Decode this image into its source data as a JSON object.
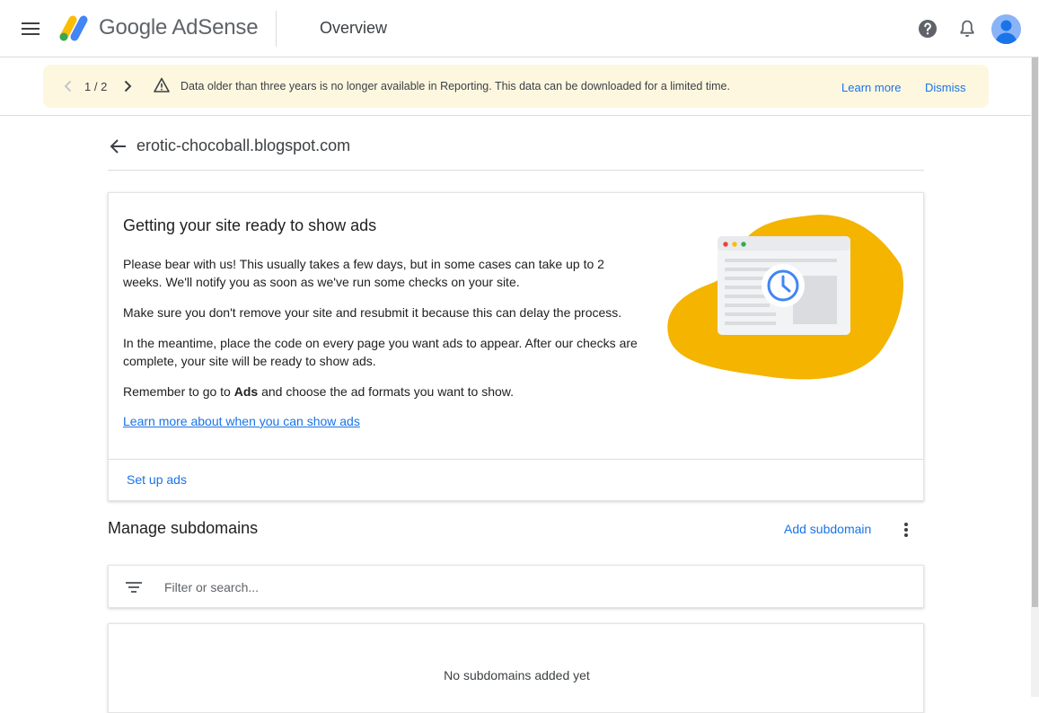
{
  "app": {
    "brand": "Google AdSense",
    "page_title": "Overview"
  },
  "icons": {
    "menu": "menu-icon",
    "help": "help-icon",
    "notifications": "bell-icon",
    "account": "account-icon"
  },
  "banner": {
    "pager": "1 / 2",
    "message": "Data older than three years is no longer available in Reporting. This data can be downloaded for a limited time.",
    "learn_more": "Learn more",
    "dismiss": "Dismiss"
  },
  "site": {
    "name": "erotic-chocoball.blogspot.com"
  },
  "card": {
    "title": "Getting your site ready to show ads",
    "p1": "Please bear with us! This usually takes a few days, but in some cases can take up to 2 weeks. We'll notify you as soon as we've run some checks on your site.",
    "p2": "Make sure you don't remove your site and resubmit it because this can delay the process.",
    "p3": "In the meantime, place the code on every page you want ads to appear. After our checks are complete, your site will be ready to show ads.",
    "p4_prefix": "Remember to go to ",
    "p4_bold": "Ads",
    "p4_suffix": " and choose the ad formats you want to show.",
    "link": "Learn more about when you can show ads",
    "action": "Set up ads"
  },
  "subdomains": {
    "title": "Manage subdomains",
    "add": "Add subdomain",
    "filter_placeholder": "Filter or search...",
    "empty": "No subdomains added yet"
  },
  "colors": {
    "accent": "#1a73e8",
    "banner_bg": "#fef7e0",
    "illustration_blob": "#f4b400"
  }
}
